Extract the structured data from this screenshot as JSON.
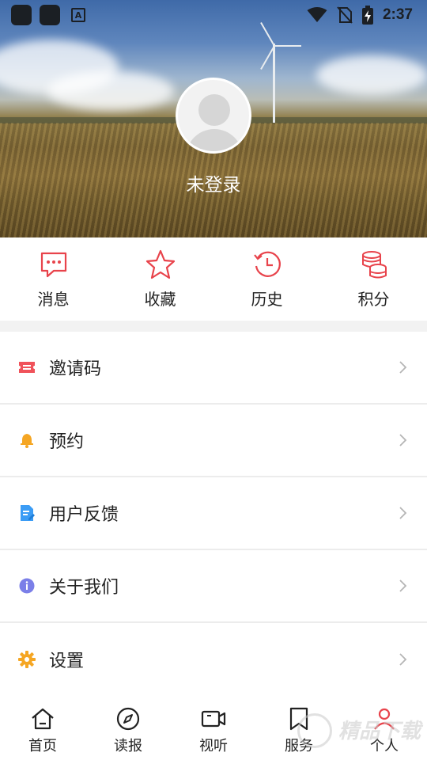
{
  "status_bar": {
    "time": "2:37",
    "icons": [
      "app-icon",
      "app-icon",
      "a-icon",
      "wifi-icon",
      "no-sim-icon",
      "battery-charging-icon"
    ]
  },
  "profile": {
    "login_status": "未登录"
  },
  "quick_actions": [
    {
      "label": "消息",
      "icon": "message-icon"
    },
    {
      "label": "收藏",
      "icon": "star-icon"
    },
    {
      "label": "历史",
      "icon": "history-icon"
    },
    {
      "label": "积分",
      "icon": "coins-icon"
    }
  ],
  "menu": [
    {
      "label": "邀请码",
      "icon": "ticket-icon",
      "color": "#f0525a"
    },
    {
      "label": "预约",
      "icon": "bell-icon",
      "color": "#f5a623"
    },
    {
      "label": "用户反馈",
      "icon": "feedback-icon",
      "color": "#3b9cf5"
    },
    {
      "label": "关于我们",
      "icon": "info-icon",
      "color": "#7b7fe8"
    },
    {
      "label": "设置",
      "icon": "gear-icon",
      "color": "#f5a623"
    }
  ],
  "bottom_nav": [
    {
      "label": "首页",
      "icon": "home-icon",
      "active": false
    },
    {
      "label": "读报",
      "icon": "compass-icon",
      "active": false
    },
    {
      "label": "视听",
      "icon": "video-icon",
      "active": false
    },
    {
      "label": "服务",
      "icon": "bookmark-icon",
      "active": false
    },
    {
      "label": "个人",
      "icon": "person-icon",
      "active": true
    }
  ],
  "colors": {
    "accent": "#e8434b",
    "icon_stroke": "#e8434b",
    "divider": "#ececec",
    "section_gap": "#f2f2f2"
  },
  "watermark": "精品下载"
}
